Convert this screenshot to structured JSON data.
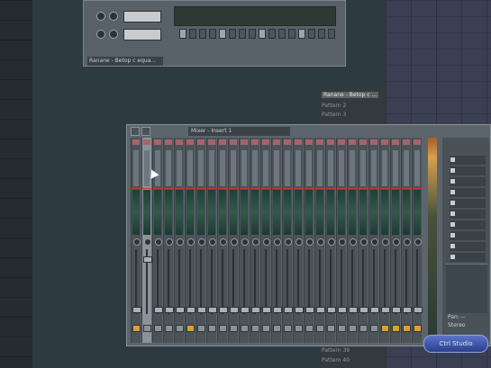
{
  "channel_rack": {
    "footer_text": "Ranane - Betop c equa..."
  },
  "pattern_list": {
    "items": [
      "Ranane - Betop c ...",
      "Pattern 2",
      "Pattern 3"
    ],
    "bottom_items": [
      "Pattern 39",
      "Pattern 40"
    ]
  },
  "mixer": {
    "title": "Mixer - Insert 1",
    "track_count": 27,
    "selected_track": 1,
    "eq_label": "Pan: --",
    "eq_sub": "Stereo"
  },
  "logo": {
    "text": "Ctrl Studio"
  },
  "colors": {
    "meter_green": "#34584c",
    "active_switch": "#e0a02e",
    "fx_slot": "#a4646c"
  }
}
